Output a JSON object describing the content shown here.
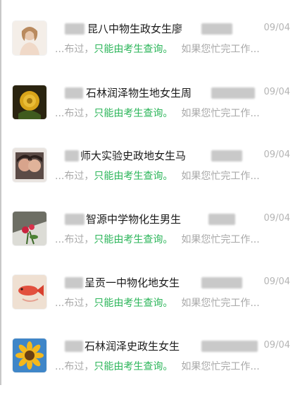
{
  "colors": {
    "accent_green": "#2bb559",
    "muted_text": "#a9a9a9",
    "date_text": "#b4b4b4"
  },
  "messages": [
    {
      "name_visible": "昆八中物生政女生廖",
      "date": "09/04",
      "preview_prefix": "...布过，",
      "preview_highlight": "只能由考生查询。",
      "preview_suffix": "如果您忙完工作...",
      "avatar_icon": "girl-portrait-icon"
    },
    {
      "name_visible": "石林润泽物生地女生周",
      "date": "09/04",
      "preview_prefix": "...布过，",
      "preview_highlight": "只能由考生查询。",
      "preview_suffix": "如果您忙完工作...",
      "avatar_icon": "yellow-rose-icon"
    },
    {
      "name_visible": "师大实验史政地女生马",
      "date": "09/04",
      "preview_prefix": "...布过，",
      "preview_highlight": "只能由考生查询。",
      "preview_suffix": "如果您忙完工作...",
      "avatar_icon": "couple-photo-icon"
    },
    {
      "name_visible": "智源中学物化生男生",
      "date": "09/04",
      "preview_prefix": "...布过，",
      "preview_highlight": "只能由考生查询。",
      "preview_suffix": "如果您忙完工作...",
      "avatar_icon": "flower-bouquet-icon"
    },
    {
      "name_visible": "呈贡一中物化地女生",
      "date": "09/04",
      "preview_prefix": "...布过，",
      "preview_highlight": "只能由考生查询。",
      "preview_suffix": "如果您忙完工作...",
      "avatar_icon": "red-fish-icon"
    },
    {
      "name_visible": "石林润泽史政生女生",
      "date": "09/04",
      "preview_prefix": "...布过，",
      "preview_highlight": "只能由考生查询。",
      "preview_suffix": "如果您忙完工作...",
      "avatar_icon": "sunflower-icon"
    }
  ]
}
